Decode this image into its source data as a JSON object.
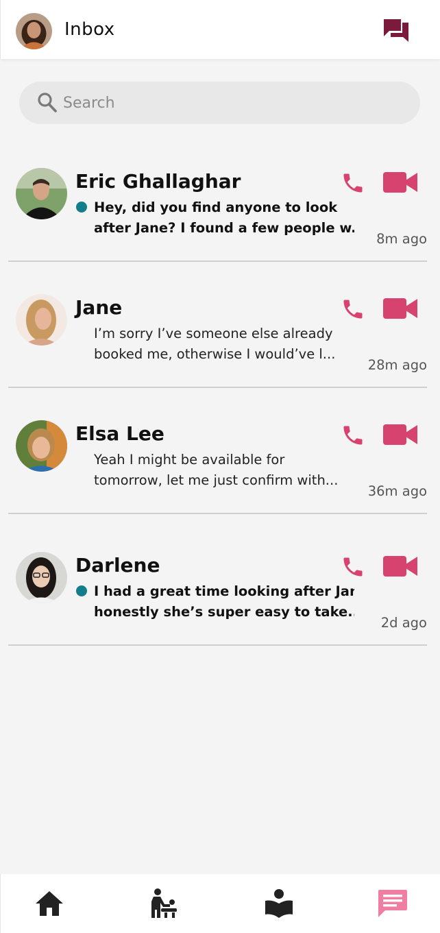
{
  "header": {
    "title": "Inbox"
  },
  "search": {
    "placeholder": "Search"
  },
  "colors": {
    "accent": "#d6436f",
    "unread_dot": "#117e8a",
    "header_icon": "#7b1a3a",
    "active_nav": "#f07ea2",
    "nav_icon": "#222222"
  },
  "conversations": [
    {
      "name": "Eric Ghallaghar",
      "line1": "Hey, did you find anyone to look",
      "line2": "after Jane? I found a few people w...",
      "time": "8m ago",
      "unread": true
    },
    {
      "name": "Jane",
      "line1": "I’m sorry I’ve someone else already",
      "line2": "booked me, otherwise I would’ve l...",
      "time": "28m ago",
      "unread": false
    },
    {
      "name": "Elsa Lee",
      "line1": "Yeah I might be available for",
      "line2": "tomorrow, let me just confirm with...",
      "time": "36m ago",
      "unread": false
    },
    {
      "name": "Darlene",
      "line1": "I had a great time looking after Jane,",
      "line2": "honestly she’s super easy to take...",
      "time": "2d ago",
      "unread": true
    }
  ],
  "bottom_nav": {
    "items": [
      {
        "icon": "home-icon",
        "active": false
      },
      {
        "icon": "baby-changing-icon",
        "active": false
      },
      {
        "icon": "reading-person-icon",
        "active": false
      },
      {
        "icon": "chat-message-icon",
        "active": true
      }
    ]
  }
}
